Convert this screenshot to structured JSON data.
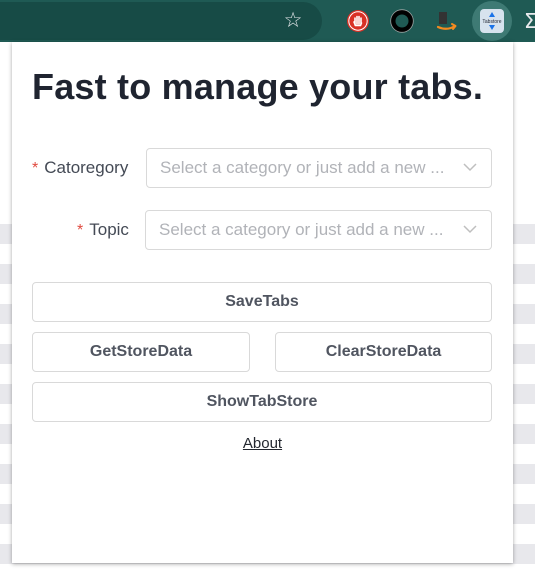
{
  "toolbar": {
    "bookmark_icon": "star-outline-icon",
    "extensions": [
      {
        "name": "adblock-hand-icon",
        "color": "#d93025"
      },
      {
        "name": "ring-icon",
        "color": "#000000"
      },
      {
        "name": "arrow-extension-icon",
        "color": "#f28b20"
      },
      {
        "name": "tabstore-extension-icon",
        "label": "Tabstore",
        "color": "#1a73e8"
      }
    ]
  },
  "popup": {
    "title": "Fast to manage your tabs.",
    "fields": {
      "category": {
        "required_mark": "*",
        "label": "Catoregory",
        "placeholder": "Select a category or just add a new ..."
      },
      "topic": {
        "required_mark": "*",
        "label": "Topic",
        "placeholder": "Select a category or just add a new ..."
      }
    },
    "buttons": {
      "save_tabs": "SaveTabs",
      "get_store_data": "GetStoreData",
      "clear_store_data": "ClearStoreData",
      "show_tab_store": "ShowTabStore"
    },
    "about_link": "About"
  },
  "colors": {
    "toolbar_bg": "#1f5a54",
    "required_red": "#e04a3f",
    "title_text": "#1f2430",
    "placeholder": "#b1b3b8",
    "border": "#d9d9d9"
  }
}
